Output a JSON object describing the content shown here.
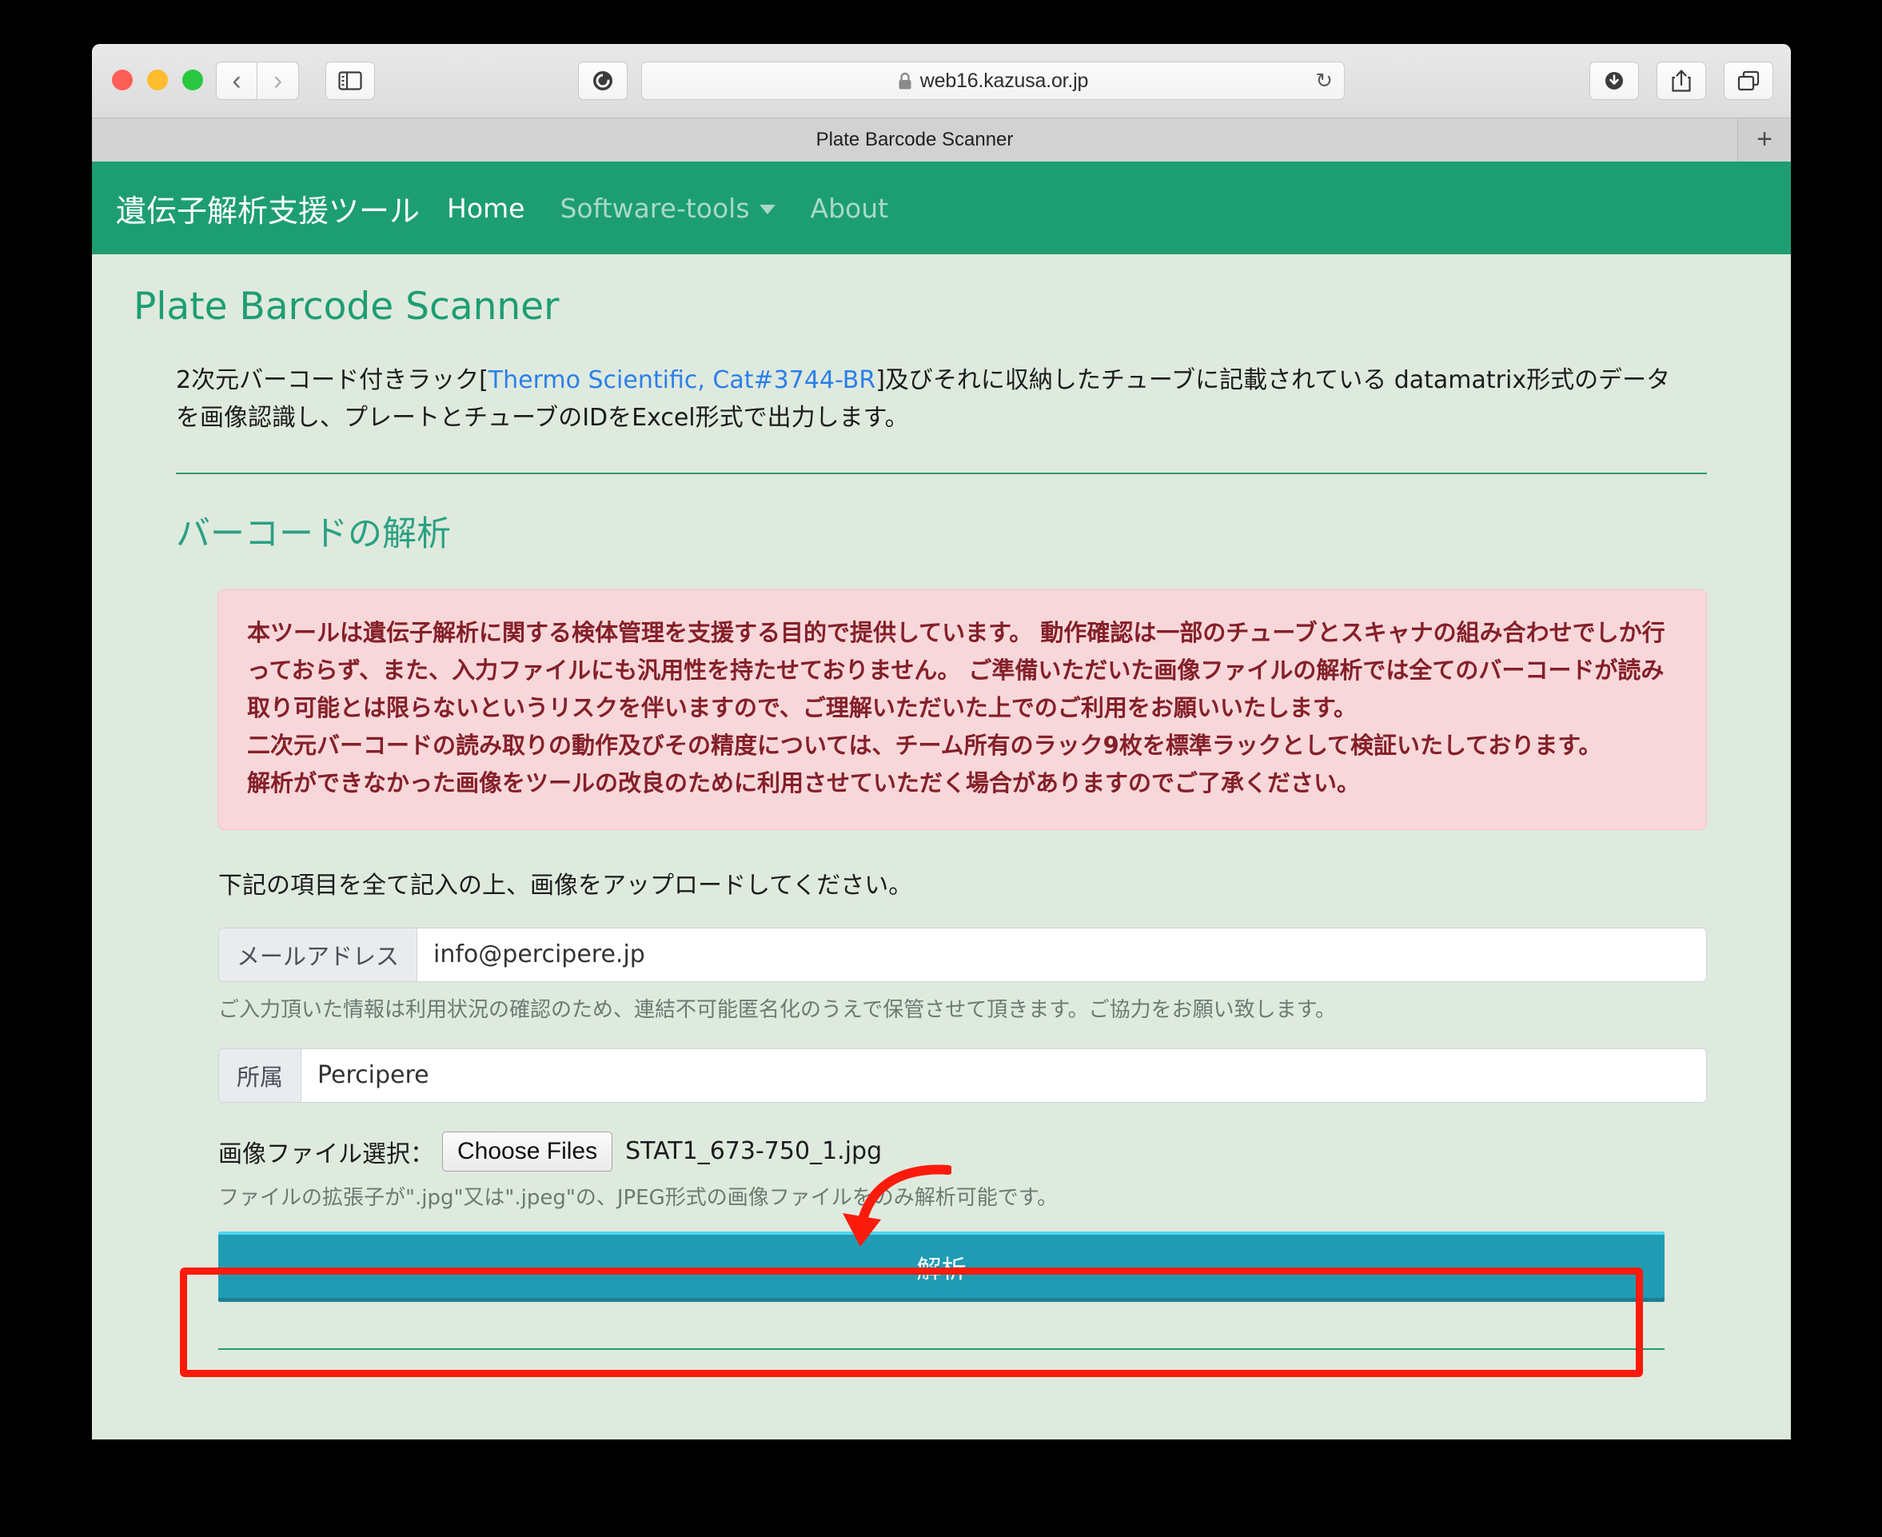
{
  "browser": {
    "traffic_lights": [
      "close",
      "minimize",
      "maximize"
    ],
    "back_icon": "chevron-left-icon",
    "forward_icon": "chevron-right-icon",
    "sidebar_icon": "sidebar-icon",
    "reader_icon": "reader-view-icon",
    "url": "web16.kazusa.or.jp",
    "lock_icon": "lock-icon",
    "reload_icon": "reload-icon",
    "download_icon": "download-icon",
    "share_icon": "share-icon",
    "tabs_icon": "tab-overview-icon",
    "new_tab_label": "+",
    "tab_title": "Plate Barcode Scanner"
  },
  "navbar": {
    "brand": "遺伝子解析支援ツール",
    "links": [
      {
        "label": "Home",
        "state": "active"
      },
      {
        "label": "Software-tools",
        "state": "muted",
        "has_caret": true
      },
      {
        "label": "About",
        "state": "muted"
      }
    ]
  },
  "main": {
    "page_title": "Plate Barcode Scanner",
    "lead_part1": "2次元バーコード付きラック[",
    "lead_link": "Thermo Scientific, Cat#3744-BR",
    "lead_part2": "]及びそれに収納したチューブに記載されている datamatrix形式のデータを画像認識し、プレートとチューブのIDをExcel形式で出力します。",
    "section_title": "バーコードの解析",
    "alert_lines": [
      "本ツールは遺伝子解析に関する検体管理を支援する目的で提供しています。 動作確認は一部のチューブとスキャナの組み合わせでしか行っておらず、また、入力ファイルにも汎用性を持たせておりません。 ご準備いただいた画像ファイルの解析では全てのバーコードが読み取り可能とは限らないというリスクを伴いますので、ご理解いただいた上でのご利用をお願いいたします。",
      "二次元バーコードの読み取りの動作及びその精度については、チーム所有のラック9枚を標準ラックとして検証いたしております。",
      "解析ができなかった画像をツールの改良のために利用させていただく場合がありますのでご了承ください。"
    ],
    "upload_note": "下記の項目を全て記入の上、画像をアップロードしてください。",
    "email_field": {
      "label": "メールアドレス",
      "value": "info@percipere.jp",
      "placeholder": "メールアドレス"
    },
    "email_help": "ご入力頂いた情報は利用状況の確認のため、連結不可能匿名化のうえで保管させて頂きます。ご協力をお願い致します。",
    "affiliation_field": {
      "label": "所属",
      "value": "Percipere",
      "placeholder": "所属"
    },
    "file_row": {
      "label": "画像ファイル選択：",
      "button_label": "Choose Files",
      "file_name": "STAT1_673-750_1.jpg"
    },
    "file_help": "ファイルの拡張子が\".jpg\"又は\".jpeg\"の、JPEG形式の画像ファイルをのみ解析可能です。",
    "submit_label": "解析"
  },
  "colors": {
    "brand_green": "#1d9e72",
    "page_bg": "#dfeade",
    "alert_bg": "#f8d7da",
    "alert_text": "#842029",
    "submit_bg": "#1f9cb4",
    "link_blue": "#2b7fea",
    "annotation_red": "#fb1b0c"
  },
  "annotations": {
    "arrow": "red-arrow-pointing-to-file-name",
    "highlight_box": "red-box-around-analyze-button"
  }
}
